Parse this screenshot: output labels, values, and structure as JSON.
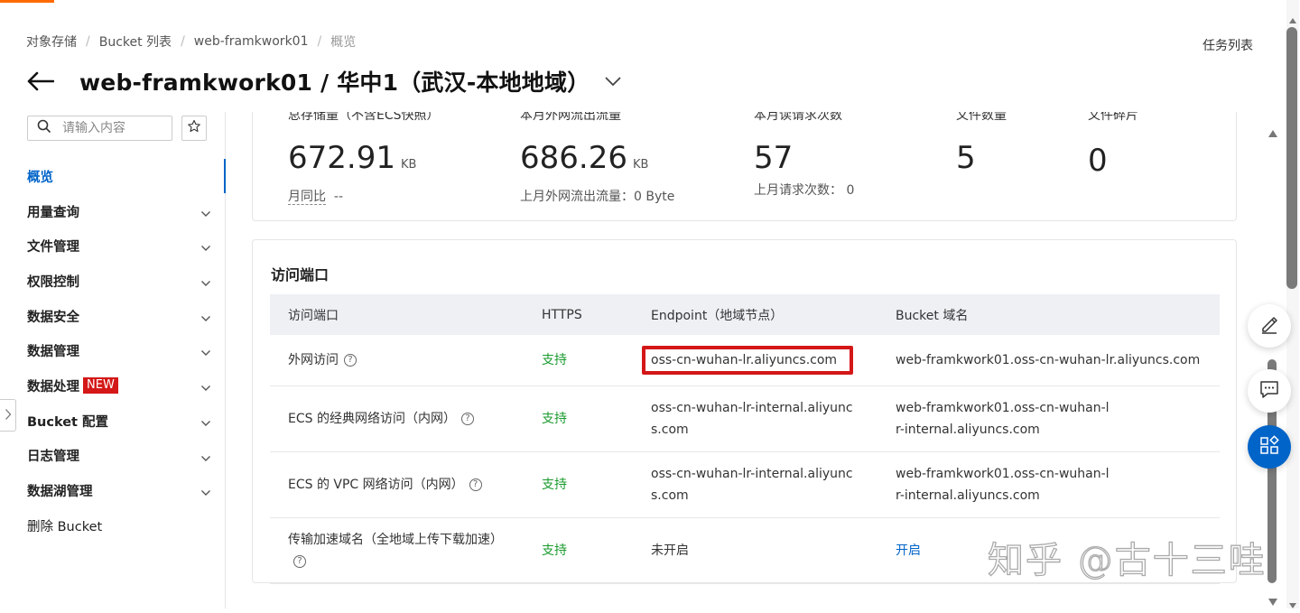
{
  "breadcrumb": [
    "对象存储",
    "Bucket 列表",
    "web-framkwork01",
    "概览"
  ],
  "task_list_label": "任务列表",
  "page_title": "web-framkwork01 / 华中1（武汉-本地地域）",
  "sidebar": {
    "search_placeholder": "请输入内容",
    "items": [
      {
        "label": "概览",
        "active": true
      },
      {
        "label": "用量查询"
      },
      {
        "label": "文件管理"
      },
      {
        "label": "权限控制"
      },
      {
        "label": "数据安全"
      },
      {
        "label": "数据管理"
      },
      {
        "label": "数据处理",
        "badge": "NEW"
      },
      {
        "label": "Bucket 配置"
      },
      {
        "label": "日志管理"
      },
      {
        "label": "数据湖管理"
      },
      {
        "label": "删除 Bucket"
      }
    ]
  },
  "stats": [
    {
      "label": "总存储量（不含ECS快照）",
      "value": "672.91",
      "unit": "KB",
      "sub": "月同比",
      "sub_value": "--"
    },
    {
      "label": "本月外网流出流量",
      "value": "686.26",
      "unit": "KB",
      "sub": "上月外网流出流量：0 Byte"
    },
    {
      "label": "本月读请求次数",
      "value": "57",
      "sub": "上月请求次数：  0"
    },
    {
      "label": "文件数量",
      "value": "5"
    },
    {
      "label": "文件碎片",
      "value": "0"
    }
  ],
  "endpoints": {
    "title": "访问端口",
    "headers": [
      "访问端口",
      "HTTPS",
      "Endpoint（地域节点）",
      "Bucket 域名"
    ],
    "rows": [
      {
        "name": "外网访问",
        "https": "支持",
        "endpoint": "oss-cn-wuhan-lr.aliyuncs.com",
        "domain": "web-framkwork01.oss-cn-wuhan-lr.aliyuncs.com"
      },
      {
        "name": "ECS 的经典网络访问（内网）",
        "https": "支持",
        "endpoint": "oss-cn-wuhan-lr-internal.aliyuncs.com",
        "domain": "web-framkwork01.oss-cn-wuhan-lr-internal.aliyuncs.com"
      },
      {
        "name": "ECS 的 VPC 网络访问（内网）",
        "https": "支持",
        "endpoint": "oss-cn-wuhan-lr-internal.aliyuncs.com",
        "domain": "web-framkwork01.oss-cn-wuhan-lr-internal.aliyuncs.com"
      },
      {
        "name": "传输加速域名（全地域上传下载加速）",
        "https": "支持",
        "endpoint": "未开启",
        "domain": "开启"
      }
    ]
  },
  "watermark": "知乎 @古十三哇",
  "colors": {
    "accent": "#0064c8",
    "success": "#1a9b2e",
    "highlight": "#d41717",
    "brand_top": "#ff6a00"
  }
}
